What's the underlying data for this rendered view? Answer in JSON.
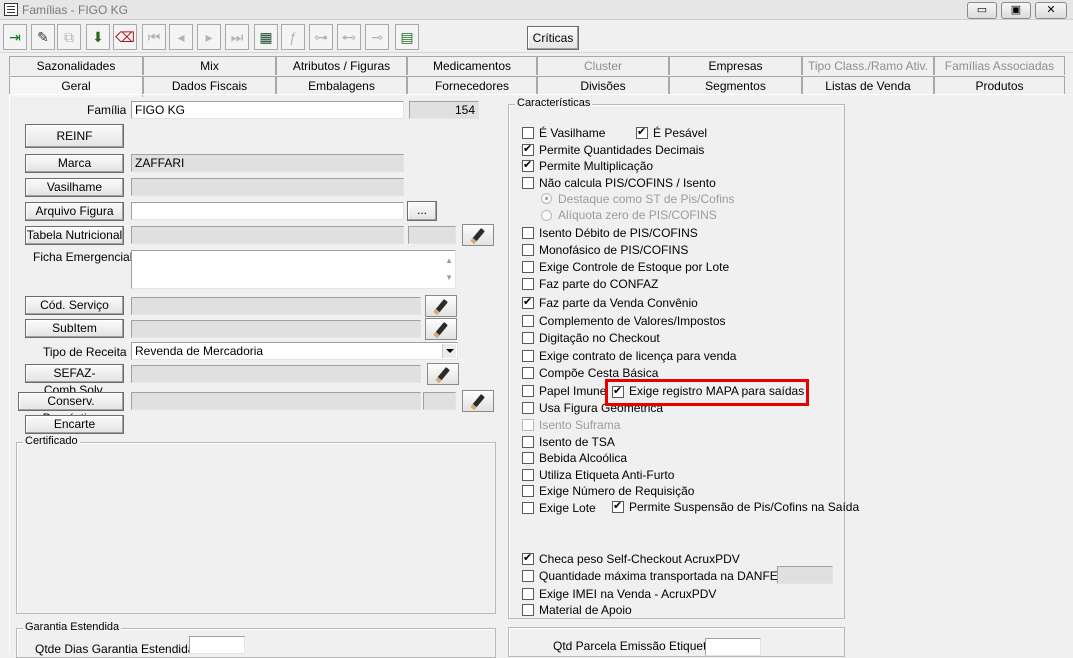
{
  "window": {
    "title": "Famílias - FIGO KG",
    "minimize": "▭",
    "restore": "▣",
    "close": "✕"
  },
  "toolbar": {
    "criticas_label": "Críticas"
  },
  "tabs": {
    "row1": [
      "Sazonalidades",
      "Mix",
      "Atributos / Figuras",
      "Medicamentos",
      "Cluster",
      "Empresas",
      "Tipo Class./Ramo Ativ.",
      "Famílias Associadas"
    ],
    "row2": [
      "Geral",
      "Dados Fiscais",
      "Embalagens",
      "Fornecedores",
      "Divisões",
      "Segmentos",
      "Listas de Venda",
      "Produtos"
    ]
  },
  "left": {
    "familia_label": "Família",
    "familia_value": "FIGO KG",
    "familia_code": "154",
    "reinf_button": "REINF",
    "marca_button": "Marca",
    "marca_value": "ZAFFARI",
    "vasilhame_button": "Vasilhame",
    "arquivo_figura_button": "Arquivo Figura",
    "browse_button": "...",
    "tabela_nutricional_button": "Tabela Nutricional",
    "ficha_emergencial_label": "Ficha Emergencial",
    "cod_servico_button": "Cód. Serviço",
    "subitem_button": "SubItem",
    "tipo_receita_label": "Tipo de Receita",
    "tipo_receita_value": "Revenda de Mercadoria",
    "sefaz_button": "SEFAZ-Comb.Solv.",
    "conserv_button": "Conserv. Doméstica",
    "encarte_button": "Encarte",
    "certificado_legend": "Certificado",
    "garantia_legend": "Garantia Estendida",
    "garantia_dias_label": "Qtde Dias Garantia Estendida"
  },
  "caracteristicas": {
    "legend": "Características",
    "items": [
      {
        "label": "É Vasilhame",
        "checked": false
      },
      {
        "label": "Permite Quantidades Decimais",
        "checked": true
      },
      {
        "label": "Permite Multiplicação",
        "checked": true
      },
      {
        "label": "Não calcula PIS/COFINS / Isento",
        "checked": false
      },
      {
        "label": "Isento Débito de PIS/COFINS",
        "checked": false
      },
      {
        "label": "Monofásico de PIS/COFINS",
        "checked": false
      },
      {
        "label": "Exige Controle de Estoque por Lote",
        "checked": false
      },
      {
        "label": "Faz parte do CONFAZ",
        "checked": false
      },
      {
        "label": "Faz parte da Venda Convênio",
        "checked": true
      },
      {
        "label": "Complemento de Valores/Impostos",
        "checked": false
      },
      {
        "label": "Digitação no Checkout",
        "checked": false
      },
      {
        "label": "Exige contrato de licença para venda",
        "checked": false
      },
      {
        "label": "Compõe Cesta Básica",
        "checked": false
      },
      {
        "label": "Papel Imune",
        "checked": false
      },
      {
        "label": "Usa Figura Geométrica",
        "checked": false
      },
      {
        "label": "Isento Suframa",
        "checked": false,
        "disabled": true
      },
      {
        "label": "Isento de TSA",
        "checked": false
      },
      {
        "label": "Bebida Alcoólica",
        "checked": false
      },
      {
        "label": "Utiliza Etiqueta Anti-Furto",
        "checked": false
      },
      {
        "label": "Exige Número de Requisição",
        "checked": false
      },
      {
        "label": "Exige Lote",
        "checked": false
      },
      {
        "label": "Checa peso Self-Checkout AcruxPDV",
        "checked": true
      },
      {
        "label": "Quantidade máxima transportada na DANFE (KG)",
        "checked": false
      },
      {
        "label": "Exige IMEI na Venda - AcruxPDV",
        "checked": false
      },
      {
        "label": "Material de Apoio",
        "checked": false
      }
    ],
    "e_pesavel": {
      "label": "É Pesável",
      "checked": true
    },
    "radio_st": "Destaque como ST de Pis/Cofins",
    "radio_aliquota": "Alíquota zero de PIS/COFINS",
    "exige_mapa": {
      "label": "Exige registro MAPA para saídas",
      "checked": true
    },
    "permite_suspensao": {
      "label": "Permite Suspensão de Pis/Cofins na Saída",
      "checked": true
    }
  },
  "bottom_right": {
    "qtd_parcela_label": "Qtd Parcela Emissão Etiqueta"
  },
  "colors": {
    "highlight": "#e80000",
    "window_bg": "#f0f0f0"
  }
}
